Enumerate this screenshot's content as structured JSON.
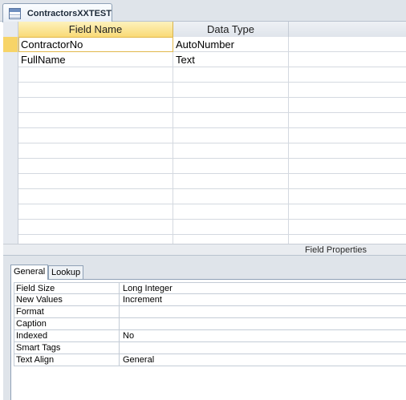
{
  "document_tab": {
    "title": "ContractorsXXTEST",
    "icon": "table-icon"
  },
  "grid": {
    "headers": {
      "field_name": "Field Name",
      "data_type": "Data Type",
      "description": ""
    },
    "rows": [
      {
        "field_name": "ContractorNo",
        "data_type": "AutoNumber",
        "description": ""
      },
      {
        "field_name": "FullName",
        "data_type": "Text",
        "description": ""
      },
      {
        "field_name": "",
        "data_type": "",
        "description": ""
      },
      {
        "field_name": "",
        "data_type": "",
        "description": ""
      },
      {
        "field_name": "",
        "data_type": "",
        "description": ""
      },
      {
        "field_name": "",
        "data_type": "",
        "description": ""
      },
      {
        "field_name": "",
        "data_type": "",
        "description": ""
      },
      {
        "field_name": "",
        "data_type": "",
        "description": ""
      },
      {
        "field_name": "",
        "data_type": "",
        "description": ""
      },
      {
        "field_name": "",
        "data_type": "",
        "description": ""
      },
      {
        "field_name": "",
        "data_type": "",
        "description": ""
      },
      {
        "field_name": "",
        "data_type": "",
        "description": ""
      },
      {
        "field_name": "",
        "data_type": "",
        "description": ""
      },
      {
        "field_name": "",
        "data_type": "",
        "description": ""
      }
    ],
    "selected_row": 0
  },
  "field_properties": {
    "title": "Field Properties",
    "tabs": [
      "General",
      "Lookup"
    ],
    "active_tab": "General",
    "properties": [
      {
        "name": "Field Size",
        "value": "Long Integer"
      },
      {
        "name": "New Values",
        "value": "Increment"
      },
      {
        "name": "Format",
        "value": ""
      },
      {
        "name": "Caption",
        "value": ""
      },
      {
        "name": "Indexed",
        "value": "No"
      },
      {
        "name": "Smart Tags",
        "value": ""
      },
      {
        "name": "Text Align",
        "value": "General"
      }
    ]
  },
  "colors": {
    "selected_header": "#f9da76",
    "selected_row_marker": "#f7d467",
    "chrome": "#dfe4ea"
  }
}
